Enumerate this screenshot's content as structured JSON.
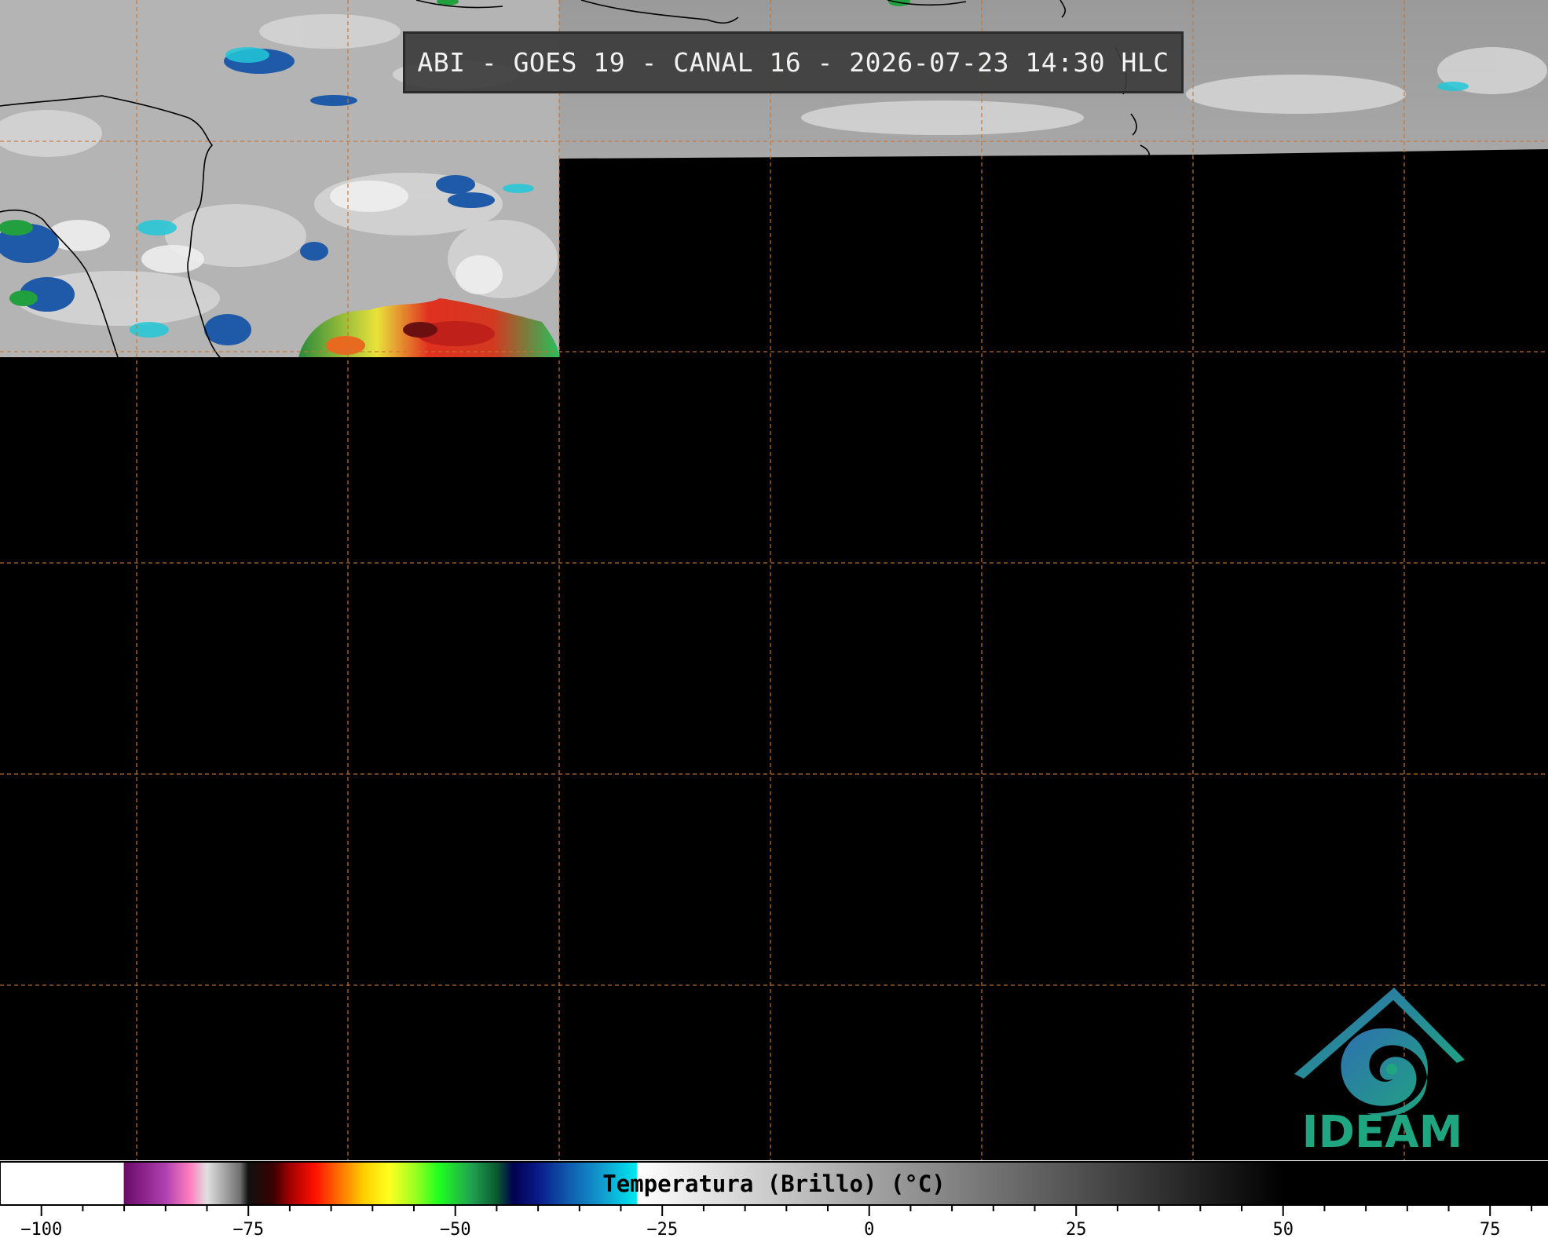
{
  "title": "ABI - GOES 19 - CANAL 16 - 2026-07-23 14:30 HLC",
  "logo_text": "IDEAM",
  "colorbar": {
    "label": "Temperatura (Brillo) (°C)",
    "range": [
      -105,
      82
    ],
    "ticks": [
      -100,
      -75,
      -50,
      -25,
      0,
      25,
      50,
      75
    ],
    "tick_labels": [
      "−100",
      "−75",
      "−50",
      "−25",
      "0",
      "25",
      "50",
      "75"
    ]
  },
  "colors": {
    "background": "#000000",
    "grid": "#c87533",
    "logo_teal": "#1fa57f",
    "logo_blue": "#2f6fb0",
    "coast": "#000000"
  }
}
